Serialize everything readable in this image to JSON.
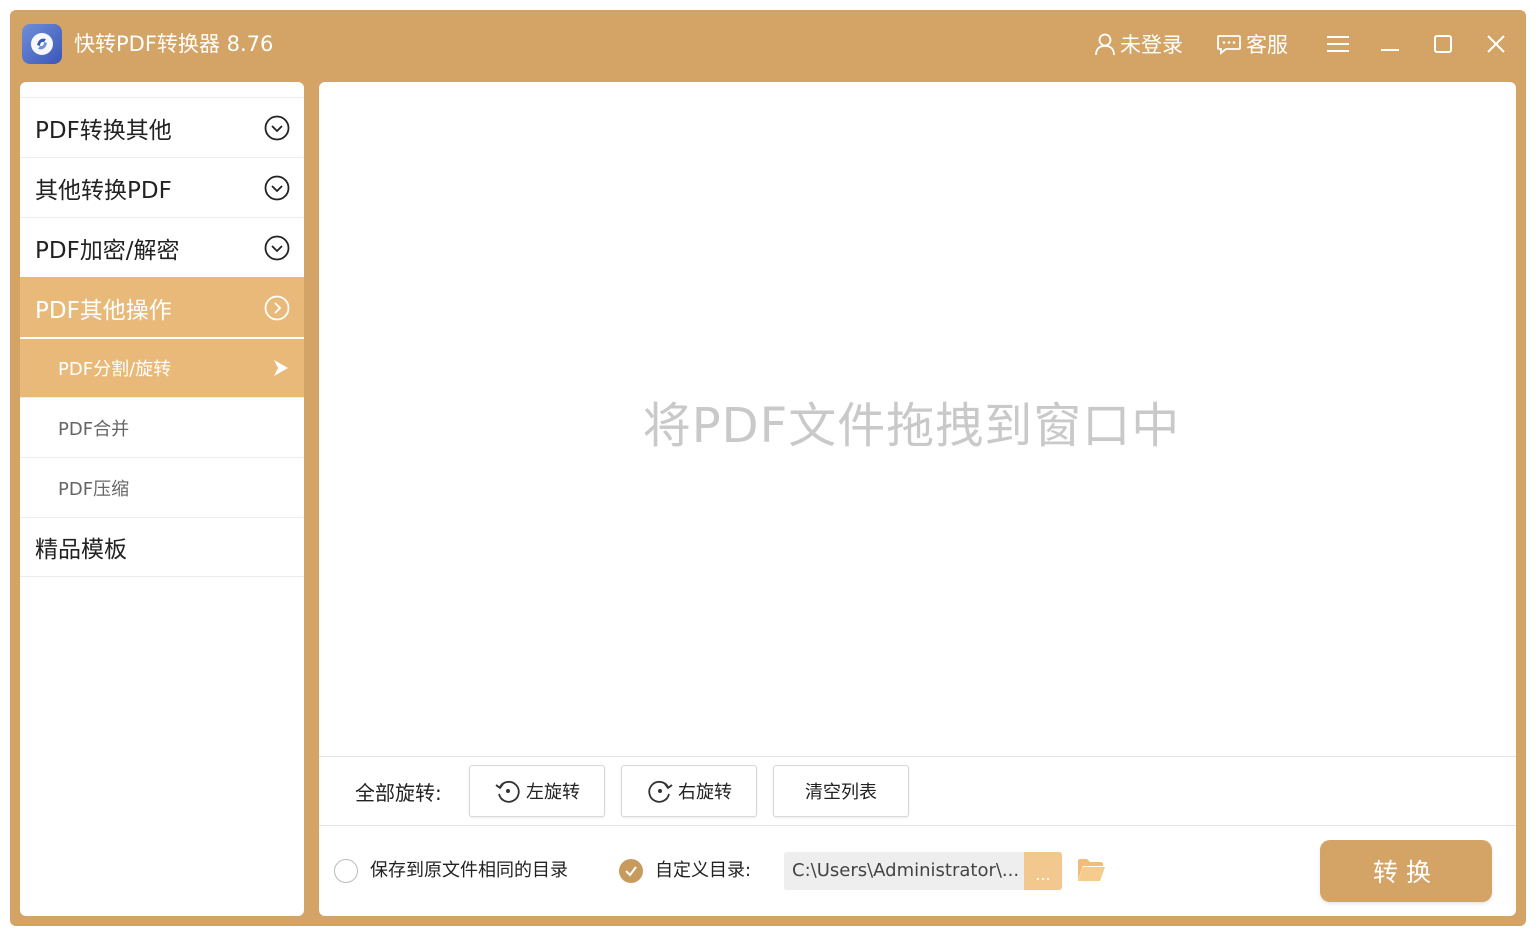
{
  "window": {
    "title": "快转PDF转换器 8.76",
    "accent_color": "#D4A366",
    "active_color": "#E9B97A"
  },
  "header": {
    "login_label": "未登录",
    "service_label": "客服",
    "icons": [
      "user-icon",
      "chat-icon",
      "menu-icon",
      "minimize-icon",
      "maximize-icon",
      "close-icon"
    ]
  },
  "sidebar": {
    "items": [
      {
        "label": "PDF转换其他",
        "icon": "chevron-down-circle-icon"
      },
      {
        "label": "其他转换PDF",
        "icon": "chevron-down-circle-icon"
      },
      {
        "label": "PDF加密/解密",
        "icon": "chevron-down-circle-icon"
      },
      {
        "label": "PDF其他操作",
        "icon": "chevron-right-circle-icon",
        "active": true
      }
    ],
    "sub_items": [
      {
        "label": "PDF分割/旋转",
        "active": true
      },
      {
        "label": "PDF合并"
      },
      {
        "label": "PDF压缩"
      }
    ],
    "templates_label": "精品模板"
  },
  "main": {
    "drop_hint": "将PDF文件拖拽到窗口中",
    "rotate_all_label": "全部旋转:",
    "rotate_left_label": "左旋转",
    "rotate_right_label": "右旋转",
    "clear_list_label": "清空列表",
    "save_same_dir_label": "保存到原文件相同的目录",
    "custom_dir_label": "自定义目录:",
    "custom_dir_path": "C:\\Users\\Administrator\\...",
    "browse_label": "...",
    "convert_label": "转换"
  }
}
